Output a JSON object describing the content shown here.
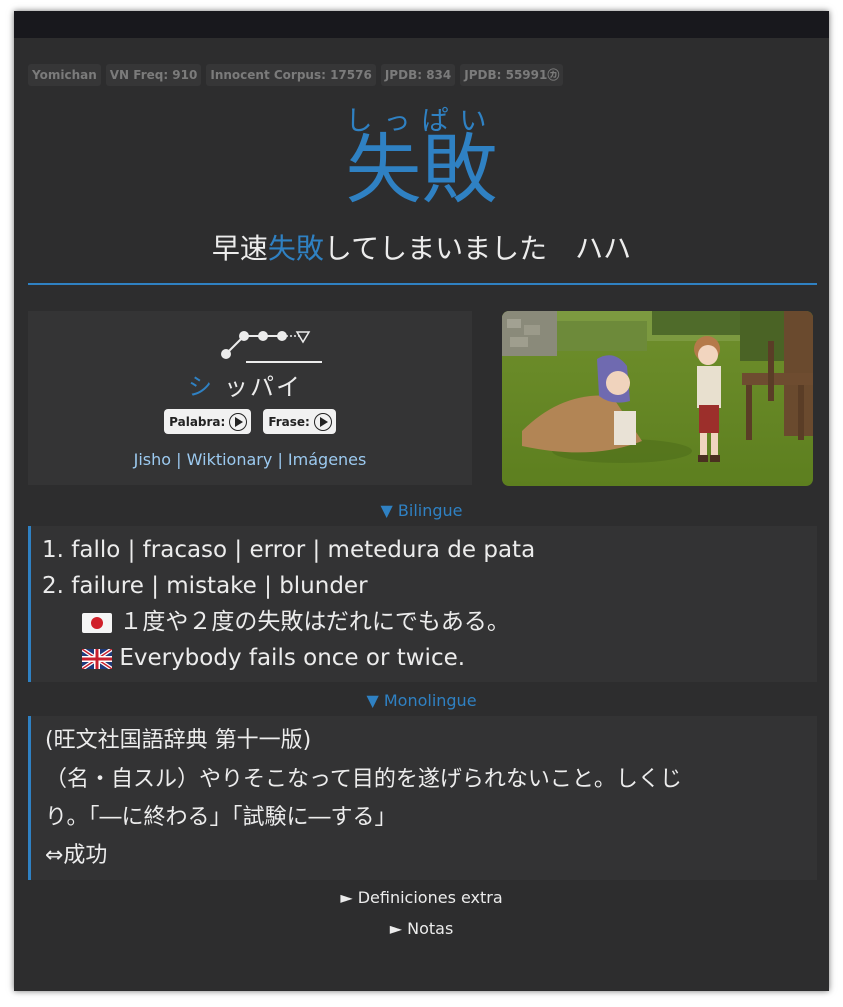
{
  "tags": [
    "Yomichan",
    "VN Freq: 910",
    "Innocent Corpus: 17576",
    "JPDB: 834",
    "JPDB: 55991㋕"
  ],
  "word": {
    "reading": "しっぱい",
    "expression": "失敗"
  },
  "sentence": {
    "before": "早速",
    "highlight": "失敗",
    "after": "してしまいました　ハハ"
  },
  "pitch": {
    "kana_first": "シ",
    "kana_rest": "ッパイ"
  },
  "audio": {
    "word_label": "Palabra:",
    "sentence_label": "Frase:"
  },
  "links": {
    "jisho": "Jisho",
    "wiktionary": "Wiktionary",
    "images": "Imágenes",
    "separator": "|"
  },
  "bilingual": {
    "toggle": "▼ Bilingue",
    "defs": [
      "1. fallo | fracaso | error | metedura de pata",
      "2. failure | mistake | blunder"
    ],
    "example_jp": "１度や２度の失敗はだれにでもある。",
    "example_en": "Everybody fails once or twice."
  },
  "monolingual": {
    "toggle": "▼ Monolingue",
    "lines": [
      "(旺文社国語辞典 第十一版)",
      "（名・自スル）やりそこなって目的を遂げられないこと。しくじ",
      "り。「―に終わる」「試験に―する」",
      "⇔成功"
    ]
  },
  "extra": {
    "definitions": "► Definiciones extra",
    "notes": "► Notas"
  },
  "colors": {
    "accent": "#2f81c3",
    "link": "#9ccaf0",
    "background": "#2d2d2e"
  }
}
